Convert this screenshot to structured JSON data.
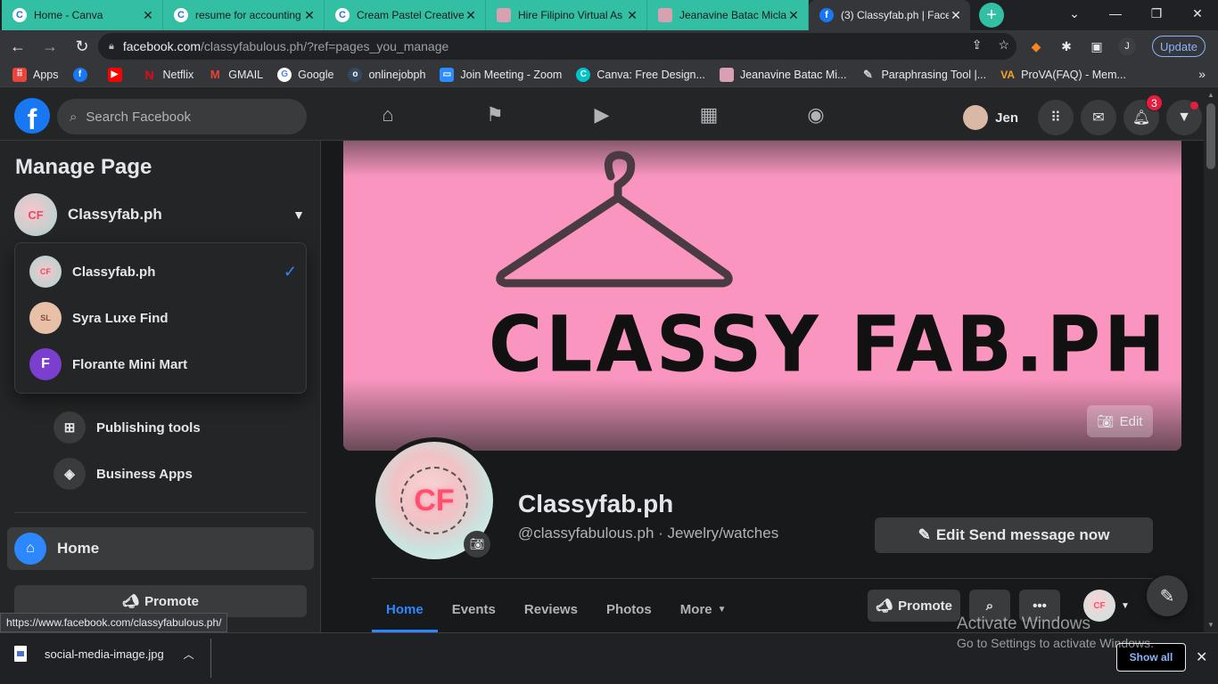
{
  "browser": {
    "tabs": [
      {
        "label": "Home - Canva",
        "icon": "C"
      },
      {
        "label": "resume for accounting",
        "icon": "C"
      },
      {
        "label": "Cream Pastel Creative",
        "icon": "C"
      },
      {
        "label": "Hire Filipino Virtual As",
        "icon": "img"
      },
      {
        "label": "Jeanavine Batac Micla",
        "icon": "img"
      },
      {
        "label": "(3) Classyfab.ph | Face",
        "icon": "f"
      }
    ],
    "new_tab": "+",
    "url_host": "facebook.com",
    "url_path": "/classyfabulous.ph/?ref=pages_you_manage",
    "update_label": "Update",
    "profile_initial": "J",
    "bookmarks": [
      {
        "label": "Apps",
        "color": "#e8453c"
      },
      {
        "label": "",
        "color": "#1877f2"
      },
      {
        "label": "",
        "color": "#ff0000"
      },
      {
        "label": "Netflix",
        "color": "#e50914"
      },
      {
        "label": "GMAIL",
        "color": "#ea4335"
      },
      {
        "label": "Google",
        "color": "#4285f4"
      },
      {
        "label": "onlinejobph",
        "color": "#34495e"
      },
      {
        "label": "Join Meeting - Zoom",
        "color": "#2d8cff"
      },
      {
        "label": "Canva: Free Design...",
        "color": "#00c4cc"
      },
      {
        "label": "Jeanavine Batac Mi...",
        "color": "#d8a0b0"
      },
      {
        "label": "Paraphrasing Tool |...",
        "color": "#888888"
      },
      {
        "label": "ProVA(FAQ) - Mem...",
        "color": "#f5a623"
      }
    ],
    "status_url": "https://www.facebook.com/classyfabulous.ph/"
  },
  "fb": {
    "search_placeholder": "Search Facebook",
    "user_name": "Jen",
    "notification_count": "3"
  },
  "sidebar": {
    "title": "Manage Page",
    "current_page": "Classyfab.ph",
    "pages": [
      {
        "name": "Classyfab.ph",
        "avatar": "CF",
        "selected": true
      },
      {
        "name": "Syra Luxe Find",
        "avatar": "SL",
        "selected": false
      },
      {
        "name": "Florante Mini Mart",
        "avatar": "F",
        "selected": false
      }
    ],
    "items": [
      {
        "label": "Publishing tools"
      },
      {
        "label": "Business Apps"
      }
    ],
    "home_label": "Home",
    "promote_label": "Promote"
  },
  "page": {
    "cover_text": "CLASSY FAB.PH",
    "cover_edit_label": "Edit",
    "avatar_text": "CF",
    "name": "Classyfab.ph",
    "subtitle": "@classyfabulous.ph · Jewelry/watches",
    "edit_send_label": "Edit Send message now",
    "tabs": [
      "Home",
      "Events",
      "Reviews",
      "Photos",
      "More"
    ],
    "promote_label": "Promote"
  },
  "windows": {
    "line1": "Activate Windows",
    "line2": "Go to Settings to activate Windows."
  },
  "downloads": {
    "file_name": "social-media-image.jpg",
    "show_all": "Show all"
  }
}
